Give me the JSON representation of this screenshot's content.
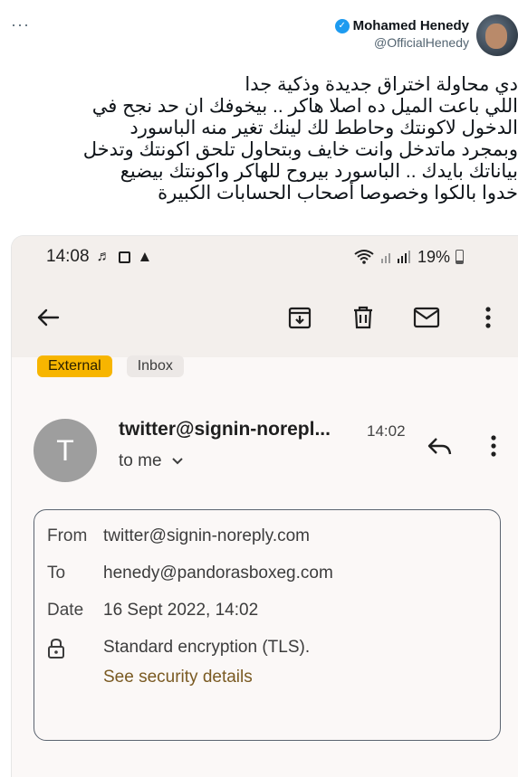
{
  "tweet": {
    "author_name": "Mohamed Henedy",
    "author_handle": "@OfficialHenedy",
    "more_label": "···",
    "lines": [
      "دي محاولة اختراق جديدة وذكية جدا",
      "اللي باعت الميل ده اصلا هاكر .. بيخوفك ان حد نجح في",
      "الدخول لاكونتك وحاطط لك لينك تغير منه الباسورد",
      "وبمجرد ماتدخل وانت خايف وبتحاول تلحق اكونتك وتدخل",
      "بياناتك بايدك .. الباسورد بيروح للهاكر واكونتك بيضيع",
      "خدوا بالكوا وخصوصا أصحاب الحسابات الكبيرة"
    ]
  },
  "phone": {
    "status": {
      "time": "14:08",
      "battery": "19%"
    },
    "labels": {
      "external": "External",
      "inbox": "Inbox"
    },
    "email": {
      "avatar_letter": "T",
      "sender": "twitter@signin-norepl...",
      "time": "14:02",
      "to": "to me",
      "from_label": "From",
      "from_value": "twitter@signin-noreply.com",
      "to_label": "To",
      "to_value": "henedy@pandorasboxeg.com",
      "date_label": "Date",
      "date_value": "16 Sept 2022, 14:02",
      "encryption": "Standard encryption (TLS).",
      "security_link": "See security details"
    },
    "icons": [
      "back-arrow-icon",
      "archive-icon",
      "trash-icon",
      "mail-icon",
      "more-vert-icon",
      "reply-icon",
      "lock-icon",
      "wifi-icon",
      "signal-icon",
      "battery-icon"
    ]
  }
}
